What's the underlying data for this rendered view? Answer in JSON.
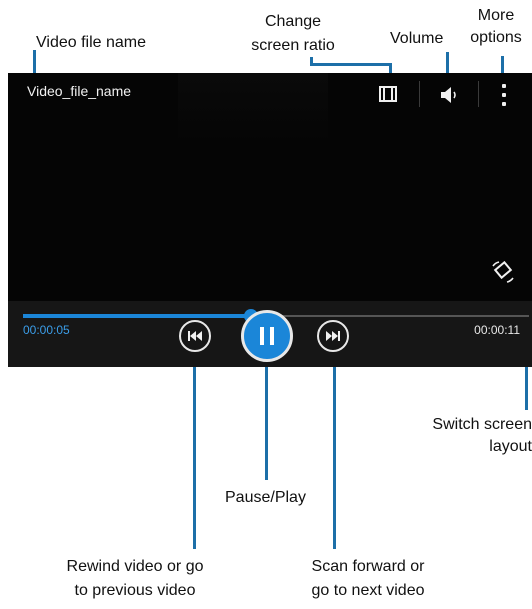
{
  "player": {
    "file_name": "Video_file_name",
    "current_time": "00:00:05",
    "total_time": "00:00:11",
    "progress_fraction": 0.45,
    "accent_color": "#1b86d8",
    "icons": {
      "screen_ratio": "screen-ratio-icon",
      "volume": "volume-icon",
      "more_options": "more-options-icon",
      "switch_layout": "rotate-screen-icon",
      "rewind": "rewind-icon",
      "pause": "pause-icon",
      "forward": "fast-forward-icon"
    }
  },
  "callouts": {
    "video_file_name": "Video file name",
    "change_ratio_line1": "Change",
    "change_ratio_line2": "screen ratio",
    "volume": "Volume",
    "more_line1": "More",
    "more_line2": "options",
    "switch_line1": "Switch screen",
    "switch_line2": "layout",
    "pause_play": "Pause/Play",
    "rewind_line1": "Rewind video or go",
    "rewind_line2": "to previous video",
    "scan_line1": "Scan forward or",
    "scan_line2": "go to next video"
  }
}
